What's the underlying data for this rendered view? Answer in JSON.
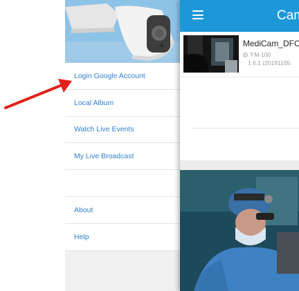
{
  "drawer": {
    "menu": [
      {
        "label": "Login Google Account"
      },
      {
        "label": "Local Album"
      },
      {
        "label": "Watch Live Events"
      },
      {
        "label": "My Live Broadcast"
      },
      {
        "label": "About"
      },
      {
        "label": "Help"
      }
    ]
  },
  "main": {
    "title": "Cam",
    "device": {
      "name": "MediCam_DFC",
      "model": "FM-100",
      "firmware": "1.6.1 (20191105."
    }
  },
  "colors": {
    "appbar": "#1c98d8",
    "menu_text": "#2f7fcf",
    "annotation_arrow": "#e3201b"
  },
  "icons": [
    "hamburger-menu-icon",
    "status-dot-icon",
    "annotation-arrow-icon"
  ]
}
